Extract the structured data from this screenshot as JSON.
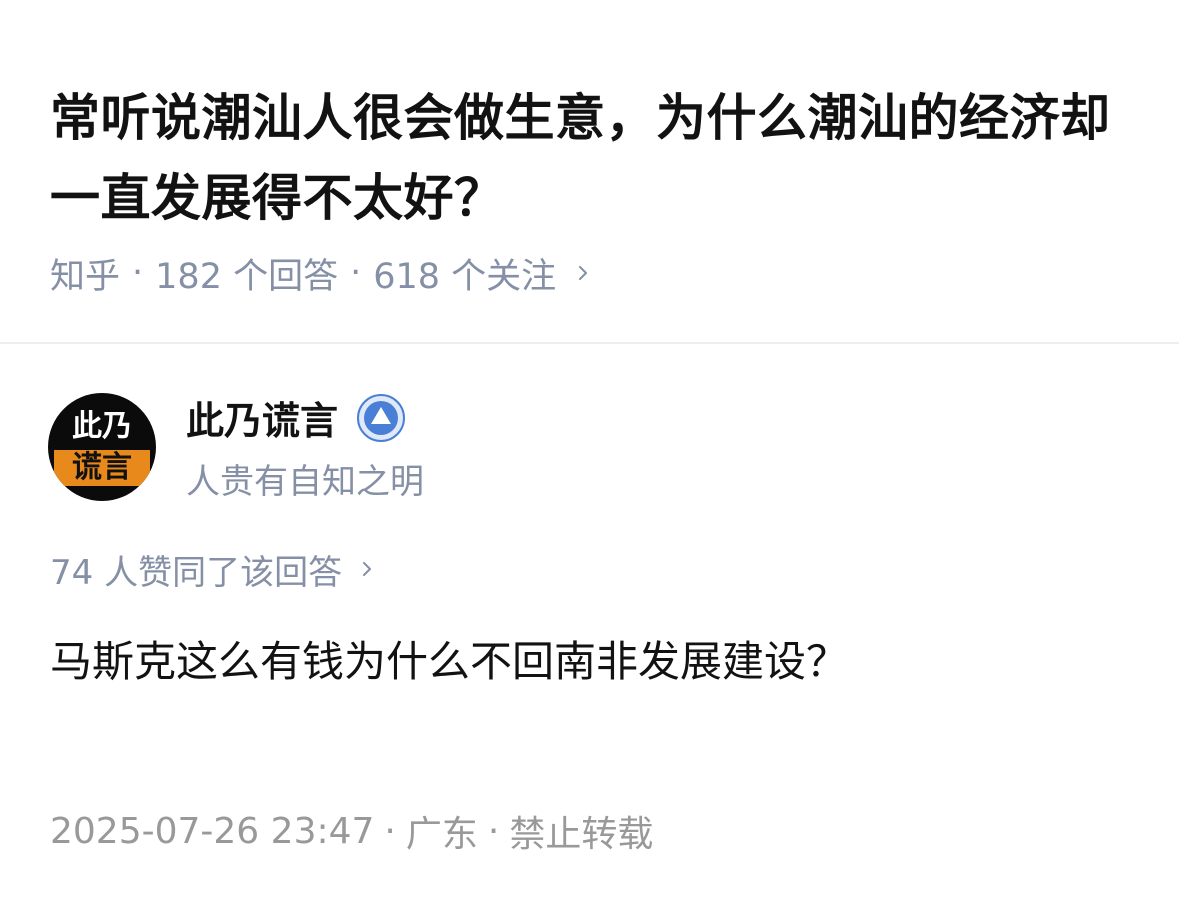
{
  "question": {
    "title": "常听说潮汕人很会做生意，为什么潮汕的经济却一直发展得不太好？",
    "source": "知乎",
    "answers": "182 个回答",
    "follows": "618 个关注",
    "separator": "·"
  },
  "author": {
    "name": "此乃谎言",
    "bio": "人贵有自知之明",
    "avatar_line1": "此乃",
    "avatar_line2": "谎言",
    "badge_icon": "verified-badge-icon"
  },
  "answer": {
    "votes": "74 人赞同了该回答",
    "content": "马斯克这么有钱为什么不回南非发展建设？",
    "datetime": "2025-07-26 23:47",
    "location": "广东",
    "copyright": "禁止转载",
    "separator": "·"
  },
  "colors": {
    "text_primary": "#121212",
    "text_secondary": "#8590a6",
    "text_tertiary": "#999999",
    "avatar_accent": "#e8891c",
    "badge_blue": "#4a7fd6",
    "divider": "#eeeeee"
  }
}
